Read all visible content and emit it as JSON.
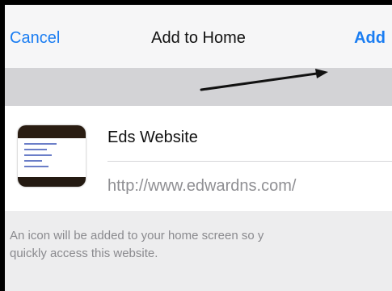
{
  "navbar": {
    "cancel_label": "Cancel",
    "title": "Add to Home",
    "add_label": "Add"
  },
  "bookmark": {
    "name": "Eds Website",
    "url": "http://www.edwardns.com/"
  },
  "footer": {
    "line1": "An icon will be added to your home screen so y",
    "line2": "quickly access this website."
  },
  "colors": {
    "accent": "#1a7df2",
    "frame": "#000000",
    "navbar_bg": "#f6f6f7",
    "band_bg": "#d3d3d6"
  },
  "icons": {
    "annotation": "arrow-icon",
    "site": "website-thumbnail"
  }
}
